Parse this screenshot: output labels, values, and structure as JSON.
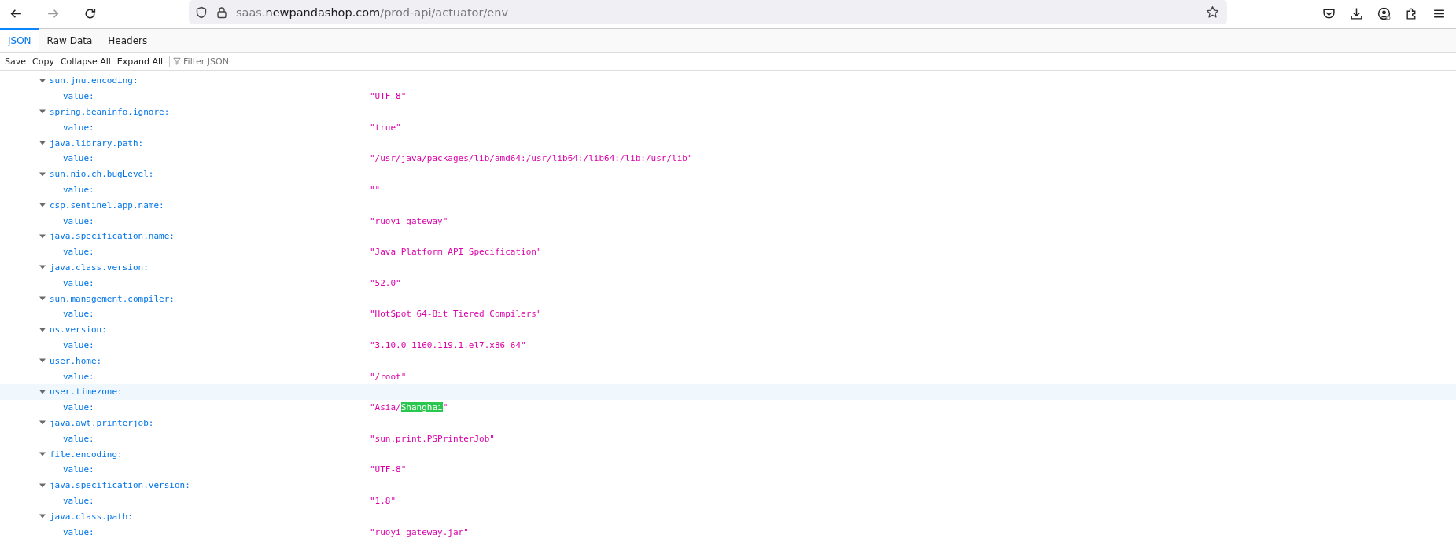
{
  "address_bar": {
    "prefix": "saas.",
    "domain": "newpandashop.com",
    "path": "/prod-api/actuator/env"
  },
  "tabs": [
    {
      "label": "JSON",
      "selected": true
    },
    {
      "label": "Raw Data",
      "selected": false
    },
    {
      "label": "Headers",
      "selected": false
    }
  ],
  "toolbar": {
    "buttons": [
      "Save",
      "Copy",
      "Collapse All",
      "Expand All"
    ],
    "filter_placeholder": "Filter JSON"
  },
  "entries": [
    {
      "key": "sun.jnu.encoding:",
      "label": "value:",
      "value": "\"UTF-8\"",
      "expanded": true,
      "selected": false
    },
    {
      "key": "spring.beaninfo.ignore:",
      "label": "value:",
      "value": "\"true\"",
      "expanded": true,
      "selected": false
    },
    {
      "key": "java.library.path:",
      "label": "value:",
      "value": "\"/usr/java/packages/lib/amd64:/usr/lib64:/lib64:/lib:/usr/lib\"",
      "expanded": true,
      "selected": false
    },
    {
      "key": "sun.nio.ch.bugLevel:",
      "label": "value:",
      "value": "\"\"",
      "expanded": true,
      "selected": false
    },
    {
      "key": "csp.sentinel.app.name:",
      "label": "value:",
      "value": "\"ruoyi-gateway\"",
      "expanded": true,
      "selected": false
    },
    {
      "key": "java.specification.name:",
      "label": "value:",
      "value": "\"Java Platform API Specification\"",
      "expanded": true,
      "selected": false
    },
    {
      "key": "java.class.version:",
      "label": "value:",
      "value": "\"52.0\"",
      "expanded": true,
      "selected": false
    },
    {
      "key": "sun.management.compiler:",
      "label": "value:",
      "value": "\"HotSpot 64-Bit Tiered Compilers\"",
      "expanded": true,
      "selected": false
    },
    {
      "key": "os.version:",
      "label": "value:",
      "value": "\"3.10.0-1160.119.1.el7.x86_64\"",
      "expanded": true,
      "selected": false
    },
    {
      "key": "user.home:",
      "label": "value:",
      "value": "\"/root\"",
      "expanded": true,
      "selected": false
    },
    {
      "key": "user.timezone:",
      "label": "value:",
      "value_parts": [
        {
          "text": "\"Asia/",
          "highlighted": false
        },
        {
          "text": "Shanghai",
          "highlighted": true
        },
        {
          "text": "\"",
          "highlighted": false
        }
      ],
      "expanded": true,
      "selected": true
    },
    {
      "key": "java.awt.printerjob:",
      "label": "value:",
      "value": "\"sun.print.PSPrinterJob\"",
      "expanded": true,
      "selected": false
    },
    {
      "key": "file.encoding:",
      "label": "value:",
      "value": "\"UTF-8\"",
      "expanded": true,
      "selected": false
    },
    {
      "key": "java.specification.version:",
      "label": "value:",
      "value": "\"1.8\"",
      "expanded": true,
      "selected": false
    },
    {
      "key": "java.class.path:",
      "label": "value:",
      "value": "\"ruoyi-gateway.jar\"",
      "expanded": true,
      "selected": false
    }
  ]
}
